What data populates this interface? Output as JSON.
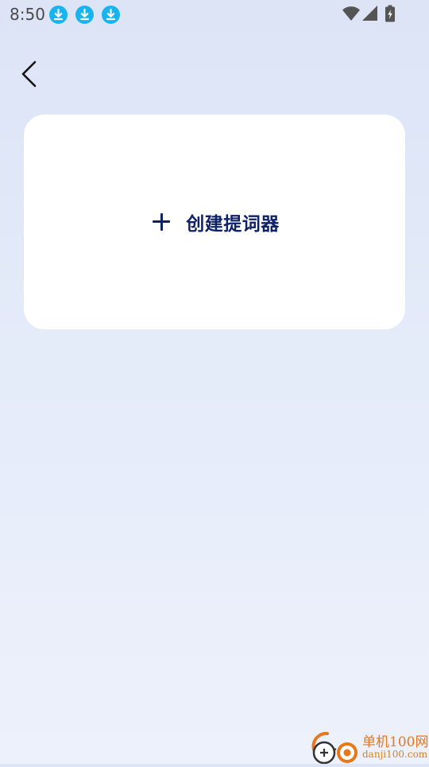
{
  "status_bar": {
    "time": "8:50",
    "notification_icons": [
      "download-icon",
      "download-icon",
      "download-icon"
    ],
    "system_icons": [
      "wifi-icon",
      "signal-icon",
      "battery-charging-icon"
    ],
    "accent_color": "#18b4f0"
  },
  "header": {
    "back_icon": "chevron-left-icon"
  },
  "create_card": {
    "icon": "plus-icon",
    "label": "创建提词器",
    "text_color": "#0f2167",
    "background": "#ffffff"
  },
  "watermark": {
    "title": "单机100网",
    "url": "danji100.com",
    "color": "#e8771a"
  }
}
